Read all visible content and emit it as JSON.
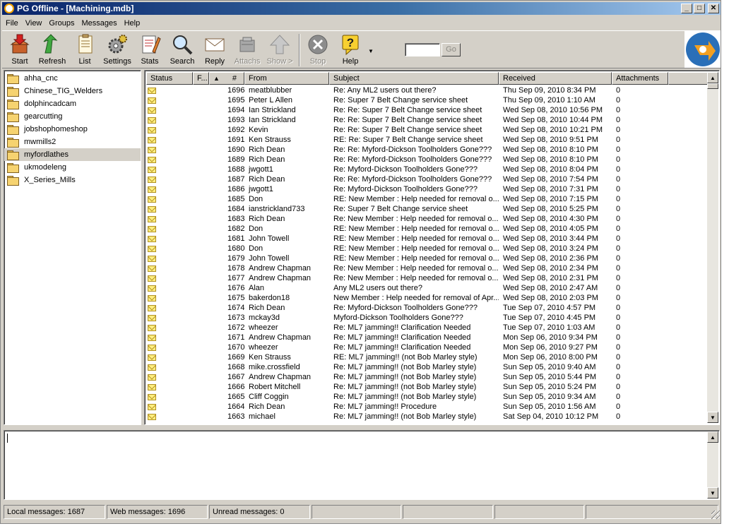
{
  "window": {
    "title": "PG Offline - [Machining.mdb]"
  },
  "menu": [
    {
      "label": "File"
    },
    {
      "label": "View"
    },
    {
      "label": "Groups"
    },
    {
      "label": "Messages"
    },
    {
      "label": "Help"
    }
  ],
  "toolbar": {
    "start": "Start",
    "refresh": "Refresh",
    "list": "List",
    "settings": "Settings",
    "stats": "Stats",
    "search": "Search",
    "reply": "Reply",
    "attachs": "Attachs",
    "show": "Show >",
    "stop": "Stop",
    "help": "Help",
    "go": "Go",
    "goto_value": ""
  },
  "folders": [
    {
      "name": "ahha_cnc"
    },
    {
      "name": "Chinese_TIG_Welders"
    },
    {
      "name": "dolphincadcam"
    },
    {
      "name": "gearcutting"
    },
    {
      "name": "jobshophomeshop"
    },
    {
      "name": "mwmills2"
    },
    {
      "name": "myfordlathes",
      "selected": true
    },
    {
      "name": "ukmodeleng"
    },
    {
      "name": "X_Series_Mills"
    }
  ],
  "columns": {
    "status": "Status",
    "flag": "F...",
    "sort_icon": "▲",
    "num": "#",
    "from": "From",
    "subject": "Subject",
    "received": "Received",
    "attachments": "Attachments"
  },
  "messages": [
    {
      "num": "1696",
      "from": "meatblubber",
      "subject": "Re: Any ML2 users out there?",
      "received": "Thu Sep 09, 2010 8:34 PM",
      "att": "0"
    },
    {
      "num": "1695",
      "from": "Peter L Allen",
      "subject": "Re: Super 7 Belt Change service sheet",
      "received": "Thu Sep 09, 2010 1:10 AM",
      "att": "0"
    },
    {
      "num": "1694",
      "from": "Ian Strickland",
      "subject": "Re: Re: Super 7 Belt Change service sheet",
      "received": "Wed Sep 08, 2010 10:56 PM",
      "att": "0"
    },
    {
      "num": "1693",
      "from": "Ian Strickland",
      "subject": "Re: Re: Super 7 Belt Change service sheet",
      "received": "Wed Sep 08, 2010 10:44 PM",
      "att": "0"
    },
    {
      "num": "1692",
      "from": "Kevin",
      "subject": "Re: Re: Super 7 Belt Change service sheet",
      "received": "Wed Sep 08, 2010 10:21 PM",
      "att": "0"
    },
    {
      "num": "1691",
      "from": "Ken Strauss",
      "subject": "RE: Re: Super 7 Belt Change service sheet",
      "received": "Wed Sep 08, 2010 9:51 PM",
      "att": "0"
    },
    {
      "num": "1690",
      "from": "Rich Dean",
      "subject": "Re: Re: Myford-Dickson Toolholders Gone???",
      "received": "Wed Sep 08, 2010 8:10 PM",
      "att": "0"
    },
    {
      "num": "1689",
      "from": "Rich Dean",
      "subject": "Re: Re: Myford-Dickson Toolholders Gone???",
      "received": "Wed Sep 08, 2010 8:10 PM",
      "att": "0"
    },
    {
      "num": "1688",
      "from": "jwgott1",
      "subject": "Re: Myford-Dickson Toolholders Gone???",
      "received": "Wed Sep 08, 2010 8:04 PM",
      "att": "0"
    },
    {
      "num": "1687",
      "from": "Rich Dean",
      "subject": "Re: Re: Myford-Dickson Toolholders Gone???",
      "received": "Wed Sep 08, 2010 7:54 PM",
      "att": "0"
    },
    {
      "num": "1686",
      "from": "jwgott1",
      "subject": "Re: Myford-Dickson Toolholders Gone???",
      "received": "Wed Sep 08, 2010 7:31 PM",
      "att": "0"
    },
    {
      "num": "1685",
      "from": "Don",
      "subject": "RE: New Member : Help needed for removal o...",
      "received": "Wed Sep 08, 2010 7:15 PM",
      "att": "0"
    },
    {
      "num": "1684",
      "from": "ianstrickland733",
      "subject": "Re: Super 7 Belt Change service sheet",
      "received": "Wed Sep 08, 2010 5:25 PM",
      "att": "0"
    },
    {
      "num": "1683",
      "from": "Rich Dean",
      "subject": "Re: New Member : Help needed for removal o...",
      "received": "Wed Sep 08, 2010 4:30 PM",
      "att": "0"
    },
    {
      "num": "1682",
      "from": "Don",
      "subject": "RE: New Member : Help needed for removal o...",
      "received": "Wed Sep 08, 2010 4:05 PM",
      "att": "0"
    },
    {
      "num": "1681",
      "from": "John Towell",
      "subject": "RE: New Member : Help needed for removal o...",
      "received": "Wed Sep 08, 2010 3:44 PM",
      "att": "0"
    },
    {
      "num": "1680",
      "from": "Don",
      "subject": "RE: New Member : Help needed for removal o...",
      "received": "Wed Sep 08, 2010 3:24 PM",
      "att": "0"
    },
    {
      "num": "1679",
      "from": "John Towell",
      "subject": "RE: New Member : Help needed for removal o...",
      "received": "Wed Sep 08, 2010 2:36 PM",
      "att": "0"
    },
    {
      "num": "1678",
      "from": "Andrew Chapman",
      "subject": "Re: New Member : Help needed for removal o...",
      "received": "Wed Sep 08, 2010 2:34 PM",
      "att": "0"
    },
    {
      "num": "1677",
      "from": "Andrew Chapman",
      "subject": "Re: New Member : Help needed for removal o...",
      "received": "Wed Sep 08, 2010 2:31 PM",
      "att": "0"
    },
    {
      "num": "1676",
      "from": "Alan",
      "subject": "Any ML2 users out there?",
      "received": "Wed Sep 08, 2010 2:47 AM",
      "att": "0"
    },
    {
      "num": "1675",
      "from": "bakerdon18",
      "subject": "New Member : Help needed for removal of Apr...",
      "received": "Wed Sep 08, 2010 2:03 PM",
      "att": "0"
    },
    {
      "num": "1674",
      "from": "Rich Dean",
      "subject": "Re: Myford-Dickson Toolholders Gone???",
      "received": "Tue Sep 07, 2010 4:57 PM",
      "att": "0"
    },
    {
      "num": "1673",
      "from": "mckay3d",
      "subject": "Myford-Dickson Toolholders Gone???",
      "received": "Tue Sep 07, 2010 4:45 PM",
      "att": "0"
    },
    {
      "num": "1672",
      "from": "wheezer",
      "subject": "Re: ML7 jamming!! Clarification Needed",
      "received": "Tue Sep 07, 2010 1:03 AM",
      "att": "0"
    },
    {
      "num": "1671",
      "from": "Andrew Chapman",
      "subject": "Re: ML7 jamming!! Clarification Needed",
      "received": "Mon Sep 06, 2010 9:34 PM",
      "att": "0"
    },
    {
      "num": "1670",
      "from": "wheezer",
      "subject": "Re: ML7 jamming!! Clarification Needed",
      "received": "Mon Sep 06, 2010 9:27 PM",
      "att": "0"
    },
    {
      "num": "1669",
      "from": "Ken Strauss",
      "subject": "RE: ML7 jamming!! (not Bob Marley style)",
      "received": "Mon Sep 06, 2010 8:00 PM",
      "att": "0"
    },
    {
      "num": "1668",
      "from": "mike.crossfield",
      "subject": "Re: ML7 jamming!! (not Bob Marley style)",
      "received": "Sun Sep 05, 2010 9:40 AM",
      "att": "0"
    },
    {
      "num": "1667",
      "from": "Andrew Chapman",
      "subject": "Re: ML7  jamming!!    (not Bob Marley style)",
      "received": "Sun Sep 05, 2010 5:44 PM",
      "att": "0"
    },
    {
      "num": "1666",
      "from": "Robert Mitchell",
      "subject": "Re: ML7  jamming!!    (not Bob Marley style)",
      "received": "Sun Sep 05, 2010 5:24 PM",
      "att": "0"
    },
    {
      "num": "1665",
      "from": "Cliff Coggin",
      "subject": "Re: ML7 jamming!! (not Bob Marley style)",
      "received": "Sun Sep 05, 2010 9:34 AM",
      "att": "0"
    },
    {
      "num": "1664",
      "from": "Rich Dean",
      "subject": "Re: ML7 jamming!! Procedure",
      "received": "Sun Sep 05, 2010 1:56 AM",
      "att": "0"
    },
    {
      "num": "1663",
      "from": "michael",
      "subject": "Re: ML7 jamming!! (not Bob Marley style)",
      "received": "Sat Sep 04, 2010 10:12 PM",
      "att": "0"
    }
  ],
  "status": {
    "local": "Local messages: 1687",
    "web": "Web messages: 1696",
    "unread": "Unread messages: 0"
  },
  "colors": {
    "titlebar": "#0a246a",
    "chrome": "#d4d0c8",
    "selected_folder": "#d4d0c8"
  }
}
